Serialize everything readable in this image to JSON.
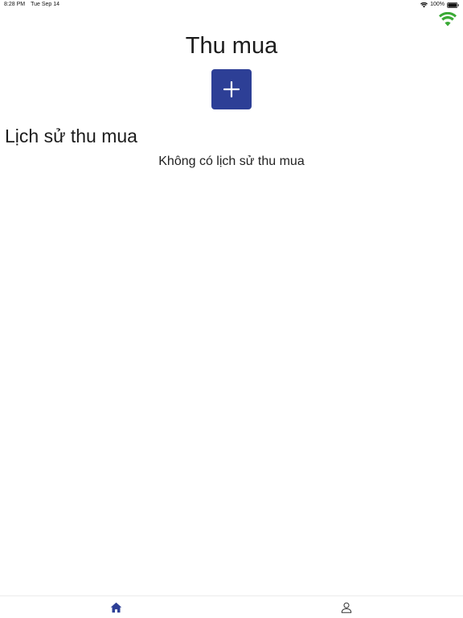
{
  "status_bar": {
    "time": "8:28 PM",
    "date": "Tue Sep 14",
    "battery": "100%"
  },
  "header": {
    "title": "Thu mua"
  },
  "history": {
    "heading": "Lịch sử thu mua",
    "empty_message": "Không có lịch sử thu mua"
  },
  "tab_bar": {
    "tabs": [
      {
        "icon": "home-icon",
        "active": true
      },
      {
        "icon": "person-icon",
        "active": false
      }
    ]
  },
  "colors": {
    "primary": "#2d3f96",
    "connection_indicator": "#3aaa35",
    "tab_active": "#2d3f96",
    "tab_inactive": "#333333"
  }
}
